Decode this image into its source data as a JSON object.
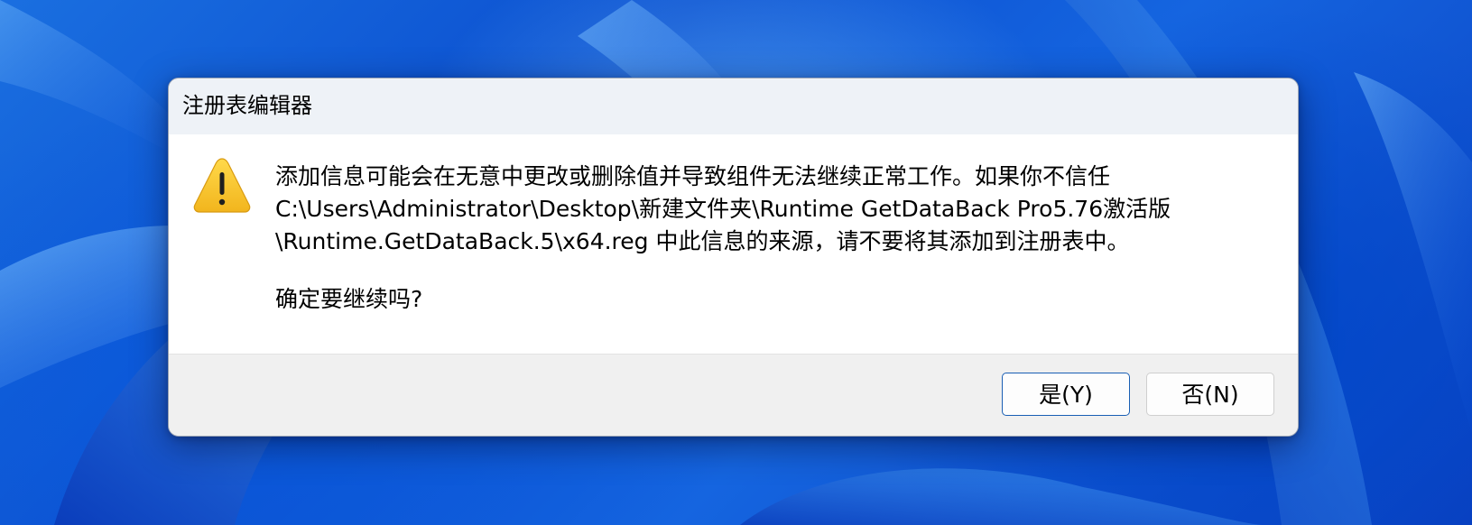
{
  "dialog": {
    "title": "注册表编辑器",
    "icon": "warning-icon",
    "message_lines": [
      "添加信息可能会在无意中更改或删除值并导致组件无法继续正常工作。如果你不信任",
      "C:\\Users\\Administrator\\Desktop\\新建文件夹\\Runtime GetDataBack Pro5.76激活版",
      "\\Runtime.GetDataBack.5\\x64.reg 中此信息的来源，请不要将其添加到注册表中。"
    ],
    "question": "确定要继续吗?",
    "buttons": {
      "yes_label": "是(Y)",
      "no_label": "否(N)"
    }
  },
  "colors": {
    "titlebar_bg": "#eef2f7",
    "footer_bg": "#f0f0f0",
    "default_button_border": "#1a5fb4",
    "warning_fill": "#f7c325",
    "desktop_blue": "#0b4fd0"
  }
}
